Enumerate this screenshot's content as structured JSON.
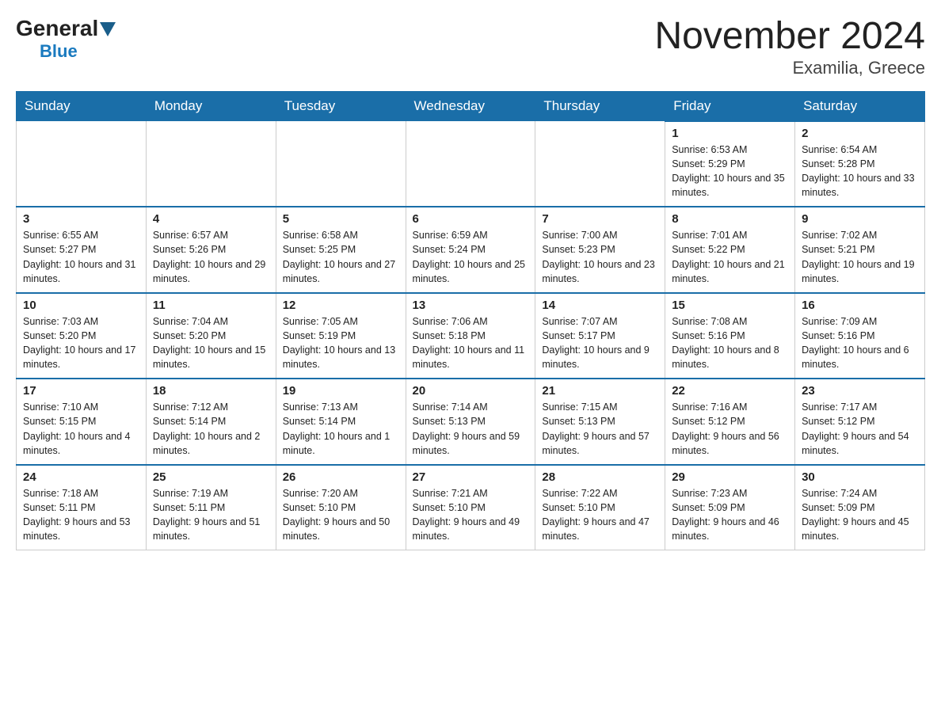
{
  "logo": {
    "general": "General",
    "blue": "Blue"
  },
  "title": {
    "month_year": "November 2024",
    "location": "Examilia, Greece"
  },
  "days_header": [
    "Sunday",
    "Monday",
    "Tuesday",
    "Wednesday",
    "Thursday",
    "Friday",
    "Saturday"
  ],
  "weeks": [
    [
      {
        "day": "",
        "info": ""
      },
      {
        "day": "",
        "info": ""
      },
      {
        "day": "",
        "info": ""
      },
      {
        "day": "",
        "info": ""
      },
      {
        "day": "",
        "info": ""
      },
      {
        "day": "1",
        "info": "Sunrise: 6:53 AM\nSunset: 5:29 PM\nDaylight: 10 hours and 35 minutes."
      },
      {
        "day": "2",
        "info": "Sunrise: 6:54 AM\nSunset: 5:28 PM\nDaylight: 10 hours and 33 minutes."
      }
    ],
    [
      {
        "day": "3",
        "info": "Sunrise: 6:55 AM\nSunset: 5:27 PM\nDaylight: 10 hours and 31 minutes."
      },
      {
        "day": "4",
        "info": "Sunrise: 6:57 AM\nSunset: 5:26 PM\nDaylight: 10 hours and 29 minutes."
      },
      {
        "day": "5",
        "info": "Sunrise: 6:58 AM\nSunset: 5:25 PM\nDaylight: 10 hours and 27 minutes."
      },
      {
        "day": "6",
        "info": "Sunrise: 6:59 AM\nSunset: 5:24 PM\nDaylight: 10 hours and 25 minutes."
      },
      {
        "day": "7",
        "info": "Sunrise: 7:00 AM\nSunset: 5:23 PM\nDaylight: 10 hours and 23 minutes."
      },
      {
        "day": "8",
        "info": "Sunrise: 7:01 AM\nSunset: 5:22 PM\nDaylight: 10 hours and 21 minutes."
      },
      {
        "day": "9",
        "info": "Sunrise: 7:02 AM\nSunset: 5:21 PM\nDaylight: 10 hours and 19 minutes."
      }
    ],
    [
      {
        "day": "10",
        "info": "Sunrise: 7:03 AM\nSunset: 5:20 PM\nDaylight: 10 hours and 17 minutes."
      },
      {
        "day": "11",
        "info": "Sunrise: 7:04 AM\nSunset: 5:20 PM\nDaylight: 10 hours and 15 minutes."
      },
      {
        "day": "12",
        "info": "Sunrise: 7:05 AM\nSunset: 5:19 PM\nDaylight: 10 hours and 13 minutes."
      },
      {
        "day": "13",
        "info": "Sunrise: 7:06 AM\nSunset: 5:18 PM\nDaylight: 10 hours and 11 minutes."
      },
      {
        "day": "14",
        "info": "Sunrise: 7:07 AM\nSunset: 5:17 PM\nDaylight: 10 hours and 9 minutes."
      },
      {
        "day": "15",
        "info": "Sunrise: 7:08 AM\nSunset: 5:16 PM\nDaylight: 10 hours and 8 minutes."
      },
      {
        "day": "16",
        "info": "Sunrise: 7:09 AM\nSunset: 5:16 PM\nDaylight: 10 hours and 6 minutes."
      }
    ],
    [
      {
        "day": "17",
        "info": "Sunrise: 7:10 AM\nSunset: 5:15 PM\nDaylight: 10 hours and 4 minutes."
      },
      {
        "day": "18",
        "info": "Sunrise: 7:12 AM\nSunset: 5:14 PM\nDaylight: 10 hours and 2 minutes."
      },
      {
        "day": "19",
        "info": "Sunrise: 7:13 AM\nSunset: 5:14 PM\nDaylight: 10 hours and 1 minute."
      },
      {
        "day": "20",
        "info": "Sunrise: 7:14 AM\nSunset: 5:13 PM\nDaylight: 9 hours and 59 minutes."
      },
      {
        "day": "21",
        "info": "Sunrise: 7:15 AM\nSunset: 5:13 PM\nDaylight: 9 hours and 57 minutes."
      },
      {
        "day": "22",
        "info": "Sunrise: 7:16 AM\nSunset: 5:12 PM\nDaylight: 9 hours and 56 minutes."
      },
      {
        "day": "23",
        "info": "Sunrise: 7:17 AM\nSunset: 5:12 PM\nDaylight: 9 hours and 54 minutes."
      }
    ],
    [
      {
        "day": "24",
        "info": "Sunrise: 7:18 AM\nSunset: 5:11 PM\nDaylight: 9 hours and 53 minutes."
      },
      {
        "day": "25",
        "info": "Sunrise: 7:19 AM\nSunset: 5:11 PM\nDaylight: 9 hours and 51 minutes."
      },
      {
        "day": "26",
        "info": "Sunrise: 7:20 AM\nSunset: 5:10 PM\nDaylight: 9 hours and 50 minutes."
      },
      {
        "day": "27",
        "info": "Sunrise: 7:21 AM\nSunset: 5:10 PM\nDaylight: 9 hours and 49 minutes."
      },
      {
        "day": "28",
        "info": "Sunrise: 7:22 AM\nSunset: 5:10 PM\nDaylight: 9 hours and 47 minutes."
      },
      {
        "day": "29",
        "info": "Sunrise: 7:23 AM\nSunset: 5:09 PM\nDaylight: 9 hours and 46 minutes."
      },
      {
        "day": "30",
        "info": "Sunrise: 7:24 AM\nSunset: 5:09 PM\nDaylight: 9 hours and 45 minutes."
      }
    ]
  ]
}
